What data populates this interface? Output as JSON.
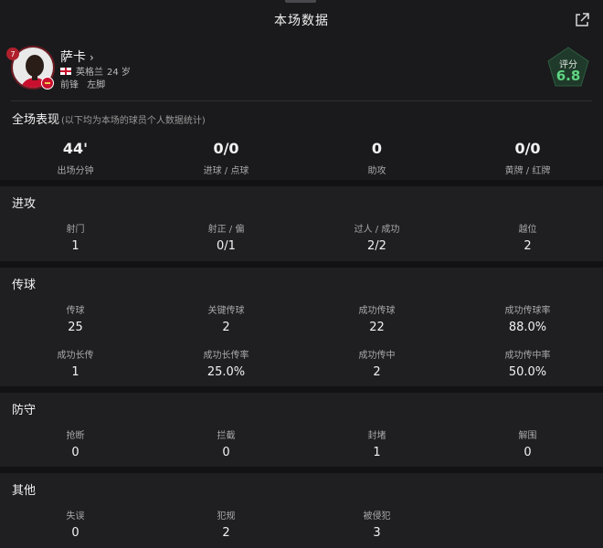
{
  "page": {
    "title": "本场数据"
  },
  "player": {
    "number": "7",
    "name": "萨卡",
    "name_chevron": "›",
    "nation": "英格兰",
    "age": "24 岁",
    "position": "前锋",
    "foot": "左脚"
  },
  "rating": {
    "label": "评分",
    "value": "6.8",
    "color": "#5ed482"
  },
  "overall": {
    "title": "全场表现",
    "note": "(以下均为本场的球员个人数据统计)",
    "stats": [
      {
        "value": "44'",
        "label": "出场分钟"
      },
      {
        "value": "0/0",
        "label": "进球 / 点球"
      },
      {
        "value": "0",
        "label": "助攻"
      },
      {
        "value": "0/0",
        "label": "黄牌 / 红牌"
      }
    ]
  },
  "attack": {
    "title": "进攻",
    "stats": [
      {
        "label": "射门",
        "value": "1"
      },
      {
        "label": "射正 / 偏",
        "value": "0/1"
      },
      {
        "label": "过人 / 成功",
        "value": "2/2"
      },
      {
        "label": "越位",
        "value": "2"
      }
    ]
  },
  "passing": {
    "title": "传球",
    "stats": [
      {
        "label": "传球",
        "value": "25"
      },
      {
        "label": "关键传球",
        "value": "2"
      },
      {
        "label": "成功传球",
        "value": "22"
      },
      {
        "label": "成功传球率",
        "value": "88.0%"
      },
      {
        "label": "成功长传",
        "value": "1"
      },
      {
        "label": "成功长传率",
        "value": "25.0%"
      },
      {
        "label": "成功传中",
        "value": "2"
      },
      {
        "label": "成功传中率",
        "value": "50.0%"
      }
    ]
  },
  "defense": {
    "title": "防守",
    "stats": [
      {
        "label": "抢断",
        "value": "0"
      },
      {
        "label": "拦截",
        "value": "0"
      },
      {
        "label": "封堵",
        "value": "1"
      },
      {
        "label": "解围",
        "value": "0"
      }
    ]
  },
  "other": {
    "title": "其他",
    "stats": [
      {
        "label": "失误",
        "value": "0"
      },
      {
        "label": "犯规",
        "value": "2"
      },
      {
        "label": "被侵犯",
        "value": "3"
      }
    ]
  },
  "icons": {
    "share": "share-icon",
    "flag": "england-flag-icon",
    "club": "arsenal-crest-icon"
  },
  "colors": {
    "accent_green": "#5ed482",
    "shirt_red": "#c8102e"
  }
}
